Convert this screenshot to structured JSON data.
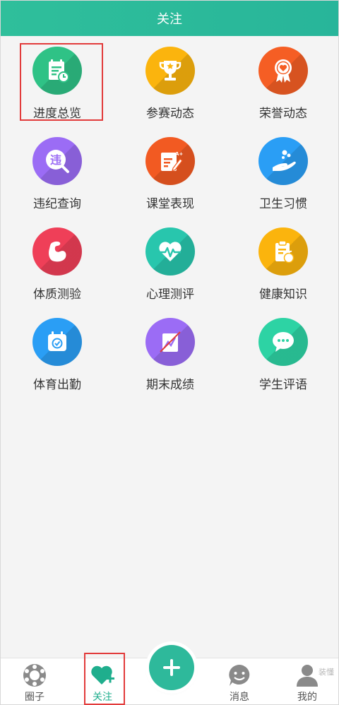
{
  "header": {
    "title": "关注"
  },
  "grid": {
    "items": [
      {
        "label": "进度总览",
        "color_a": "#3fd08f",
        "color_b": "#1fb579",
        "icon": "calendar-clock-icon"
      },
      {
        "label": "参赛动态",
        "color_a": "#ffc21a",
        "color_b": "#f7a500",
        "icon": "trophy-icon"
      },
      {
        "label": "荣誉动态",
        "color_a": "#ff7a2e",
        "color_b": "#f04d1d",
        "icon": "medal-heart-icon"
      },
      {
        "label": "违纪查询",
        "color_a": "#b388ff",
        "color_b": "#8a5ef0",
        "icon": "violation-search-icon",
        "glyph": "违"
      },
      {
        "label": "课堂表现",
        "color_a": "#ff7a2e",
        "color_b": "#ee4a1a",
        "icon": "grade-edit-icon",
        "glyph": "A+"
      },
      {
        "label": "卫生习惯",
        "color_a": "#3fb0ff",
        "color_b": "#1a8ef0",
        "icon": "hand-bubbles-icon"
      },
      {
        "label": "体质测验",
        "color_a": "#ff5a6e",
        "color_b": "#e8304a",
        "icon": "muscle-arm-icon"
      },
      {
        "label": "心理测评",
        "color_a": "#3fd8c0",
        "color_b": "#1fbfa3",
        "icon": "heart-pulse-icon"
      },
      {
        "label": "健康知识",
        "color_a": "#ffc21a",
        "color_b": "#f7a500",
        "icon": "clipboard-apple-icon"
      },
      {
        "label": "体育出勤",
        "color_a": "#3fb0ff",
        "color_b": "#1a8ef0",
        "icon": "calendar-check-icon"
      },
      {
        "label": "期末成绩",
        "color_a": "#b388ff",
        "color_b": "#8a5ef0",
        "icon": "chart-grade-icon"
      },
      {
        "label": "学生评语",
        "color_a": "#3fe0b0",
        "color_b": "#1fc79a",
        "icon": "chat-bubble-icon"
      }
    ]
  },
  "tabbar": {
    "tabs": [
      {
        "label": "圈子",
        "icon": "circle-group-icon"
      },
      {
        "label": "关注",
        "icon": "heart-plus-icon",
        "active": true
      },
      {
        "label": "消息",
        "icon": "message-face-icon"
      },
      {
        "label": "我的",
        "icon": "user-profile-icon"
      }
    ],
    "fab_icon": "plus-icon"
  },
  "watermark": "装懂"
}
